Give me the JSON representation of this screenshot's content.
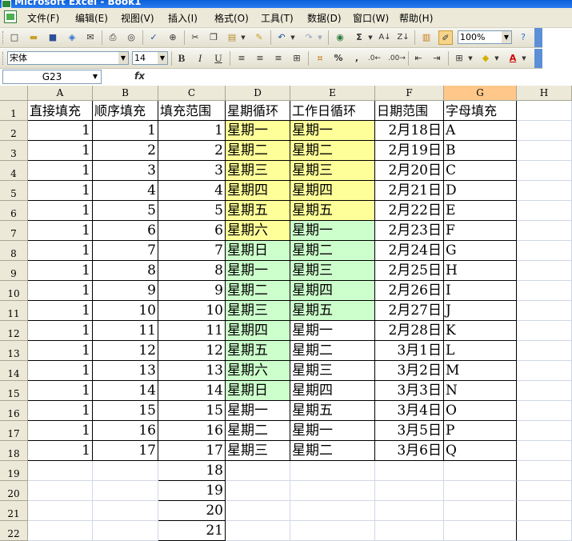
{
  "window": {
    "title": "Microsoft Excel - Book1"
  },
  "menu": [
    "文件(F)",
    "编辑(E)",
    "视图(V)",
    "插入(I)",
    "格式(O)",
    "工具(T)",
    "数据(D)",
    "窗口(W)",
    "帮助(H)"
  ],
  "toolbar": {
    "zoom": "100%",
    "font_name": "宋体",
    "font_size": "14",
    "bold": "B",
    "italic": "I",
    "underline": "U",
    "percent": "%",
    "comma": ",",
    "autosum": "Σ"
  },
  "formula_bar": {
    "name_box": "G23",
    "fx_label": "fx",
    "content": ""
  },
  "sheet": {
    "columns": [
      "A",
      "B",
      "C",
      "D",
      "E",
      "F",
      "G",
      "H"
    ],
    "selected_column": "G",
    "rows": [
      [
        "直接填充",
        "顺序填充",
        "填充范围",
        "星期循环",
        "工作日循环",
        "日期范围",
        "字母填充"
      ],
      [
        "1",
        "1",
        "1",
        "星期一",
        "星期一",
        "2月18日",
        "A"
      ],
      [
        "1",
        "2",
        "2",
        "星期二",
        "星期二",
        "2月19日",
        "B"
      ],
      [
        "1",
        "3",
        "3",
        "星期三",
        "星期三",
        "2月20日",
        "C"
      ],
      [
        "1",
        "4",
        "4",
        "星期四",
        "星期四",
        "2月21日",
        "D"
      ],
      [
        "1",
        "5",
        "5",
        "星期五",
        "星期五",
        "2月22日",
        "E"
      ],
      [
        "1",
        "6",
        "6",
        "星期六",
        "星期一",
        "2月23日",
        "F"
      ],
      [
        "1",
        "7",
        "7",
        "星期日",
        "星期二",
        "2月24日",
        "G"
      ],
      [
        "1",
        "8",
        "8",
        "星期一",
        "星期三",
        "2月25日",
        "H"
      ],
      [
        "1",
        "9",
        "9",
        "星期二",
        "星期四",
        "2月26日",
        "I"
      ],
      [
        "1",
        "10",
        "10",
        "星期三",
        "星期五",
        "2月27日",
        "J"
      ],
      [
        "1",
        "11",
        "11",
        "星期四",
        "星期一",
        "2月28日",
        "K"
      ],
      [
        "1",
        "12",
        "12",
        "星期五",
        "星期二",
        "3月1日",
        "L"
      ],
      [
        "1",
        "13",
        "13",
        "星期六",
        "星期三",
        "3月2日",
        "M"
      ],
      [
        "1",
        "14",
        "14",
        "星期日",
        "星期四",
        "3月3日",
        "N"
      ],
      [
        "1",
        "15",
        "15",
        "星期一",
        "星期五",
        "3月4日",
        "O"
      ],
      [
        "1",
        "16",
        "16",
        "星期二",
        "星期一",
        "3月5日",
        "P"
      ],
      [
        "1",
        "17",
        "17",
        "星期三",
        "星期二",
        "3月6日",
        "Q"
      ],
      [
        "",
        "",
        "18",
        "",
        "",
        "",
        ""
      ],
      [
        "",
        "",
        "19",
        "",
        "",
        "",
        ""
      ],
      [
        "",
        "",
        "20",
        "",
        "",
        "",
        ""
      ],
      [
        "",
        "",
        "21",
        "",
        "",
        "",
        ""
      ]
    ]
  },
  "colors": {
    "yellow_fill": "#ffff99",
    "green_fill": "#ccffcc",
    "header_bg": "#ece9d8",
    "selected_header": "#ffc88a"
  }
}
